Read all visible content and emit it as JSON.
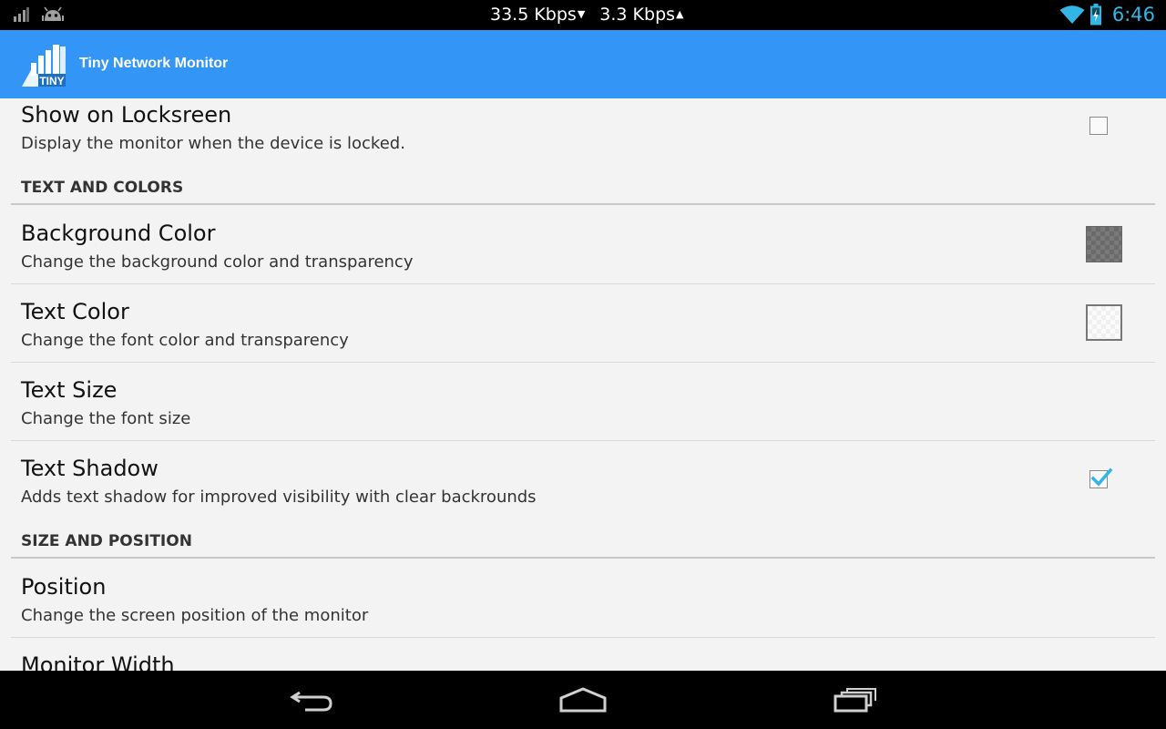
{
  "status_bar": {
    "download_speed": "33.5 Kbps",
    "download_arrow": "▼",
    "upload_speed": "3.3 Kbps",
    "upload_arrow": "▲",
    "time": "6:46",
    "icons": [
      "signal-icon",
      "android-debug-icon",
      "wifi-icon",
      "battery-icon"
    ]
  },
  "action_bar": {
    "app_title": "Tiny Network Monitor",
    "logo_text": "TINY"
  },
  "preferences": [
    {
      "type": "item",
      "title": "Show on Locksreen",
      "summary": "Display the monitor when the device is locked.",
      "widget": "checkbox",
      "checked": false
    },
    {
      "type": "category",
      "title": "TEXT AND COLORS"
    },
    {
      "type": "item",
      "title": "Background Color",
      "summary": "Change the background color and transparency",
      "widget": "color-swatch-dark"
    },
    {
      "type": "item",
      "title": "Text Color",
      "summary": "Change the font color and transparency",
      "widget": "color-swatch-light"
    },
    {
      "type": "item",
      "title": "Text Size",
      "summary": "Change the font size",
      "widget": "none"
    },
    {
      "type": "item",
      "title": "Text Shadow",
      "summary": "Adds text shadow for improved visibility with clear backrounds",
      "widget": "checkbox",
      "checked": true
    },
    {
      "type": "category",
      "title": "SIZE AND POSITION"
    },
    {
      "type": "item",
      "title": "Position",
      "summary": "Change the screen position of the monitor",
      "widget": "none"
    },
    {
      "type": "item",
      "title": "Monitor Width",
      "summary": "",
      "widget": "none"
    }
  ],
  "navigation_bar": {
    "buttons": [
      "back-icon",
      "home-icon",
      "recent-apps-icon"
    ]
  },
  "colors": {
    "action_bar": "#3395f5",
    "status_time": "#33b5e5",
    "background": "#f3f3f3",
    "check_accent": "#33b5e5"
  }
}
